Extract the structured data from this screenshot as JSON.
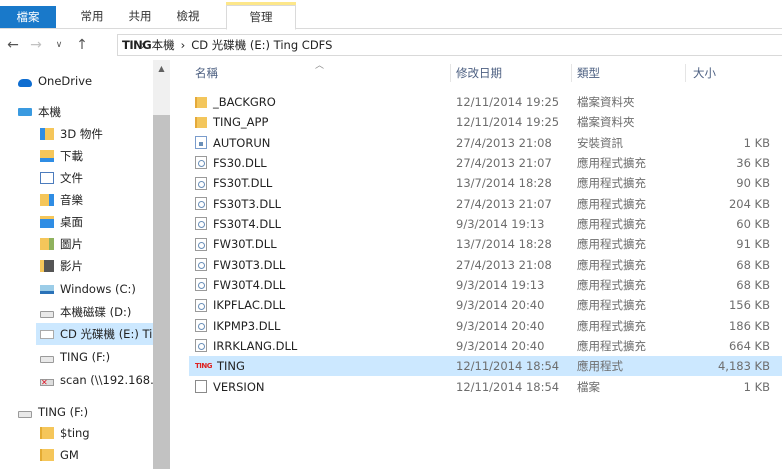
{
  "ribbon": {
    "tabs": [
      {
        "label": "檔案"
      },
      {
        "label": "常用"
      },
      {
        "label": "共用"
      },
      {
        "label": "檢視"
      },
      {
        "label": "管理"
      }
    ]
  },
  "address": {
    "logo_text": "TING",
    "crumbs": [
      "本機",
      "CD 光碟機 (E:) Ting CDFS"
    ]
  },
  "nav": {
    "items": [
      {
        "label": "OneDrive",
        "icon": "cloud-icon"
      },
      {
        "label": "本機",
        "icon": "computer-icon"
      },
      {
        "label": "3D 物件",
        "icon": "3d-objects-icon"
      },
      {
        "label": "下載",
        "icon": "downloads-icon"
      },
      {
        "label": "文件",
        "icon": "documents-icon"
      },
      {
        "label": "音樂",
        "icon": "music-icon"
      },
      {
        "label": "桌面",
        "icon": "desktop-icon"
      },
      {
        "label": "圖片",
        "icon": "pictures-icon"
      },
      {
        "label": "影片",
        "icon": "videos-icon"
      },
      {
        "label": "Windows (C:)",
        "icon": "windows-drive-icon"
      },
      {
        "label": "本機磁碟 (D:)",
        "icon": "drive-icon"
      },
      {
        "label": "CD 光碟機 (E:) Tir",
        "icon": "cd-drive-icon"
      },
      {
        "label": "TING (F:)",
        "icon": "drive-icon"
      },
      {
        "label": "scan (\\\\192.168.",
        "icon": "network-drive-icon"
      },
      {
        "label": "TING (F:)",
        "icon": "drive-icon"
      },
      {
        "label": "$ting",
        "icon": "folder-icon"
      },
      {
        "label": "GM",
        "icon": "folder-icon"
      }
    ]
  },
  "columns": {
    "name": "名稱",
    "date": "修改日期",
    "type": "類型",
    "size": "大小"
  },
  "files": [
    {
      "name": "_BACKGRO",
      "date": "12/11/2014 19:25",
      "type": "檔案資料夾",
      "size": "",
      "icon": "folder-icon"
    },
    {
      "name": "TING_APP",
      "date": "12/11/2014 19:25",
      "type": "檔案資料夾",
      "size": "",
      "icon": "folder-icon"
    },
    {
      "name": "AUTORUN",
      "date": "27/4/2013 21:08",
      "type": "安裝資訊",
      "size": "1 KB",
      "icon": "setup-info-icon"
    },
    {
      "name": "FS30.DLL",
      "date": "27/4/2013 21:07",
      "type": "應用程式擴充",
      "size": "36 KB",
      "icon": "dll-icon"
    },
    {
      "name": "FS30T.DLL",
      "date": "13/7/2014 18:28",
      "type": "應用程式擴充",
      "size": "90 KB",
      "icon": "dll-icon"
    },
    {
      "name": "FS30T3.DLL",
      "date": "27/4/2013 21:07",
      "type": "應用程式擴充",
      "size": "204 KB",
      "icon": "dll-icon"
    },
    {
      "name": "FS30T4.DLL",
      "date": "9/3/2014 19:13",
      "type": "應用程式擴充",
      "size": "60 KB",
      "icon": "dll-icon"
    },
    {
      "name": "FW30T.DLL",
      "date": "13/7/2014 18:28",
      "type": "應用程式擴充",
      "size": "91 KB",
      "icon": "dll-icon"
    },
    {
      "name": "FW30T3.DLL",
      "date": "27/4/2013 21:08",
      "type": "應用程式擴充",
      "size": "68 KB",
      "icon": "dll-icon"
    },
    {
      "name": "FW30T4.DLL",
      "date": "9/3/2014 19:13",
      "type": "應用程式擴充",
      "size": "68 KB",
      "icon": "dll-icon"
    },
    {
      "name": "IKPFLAC.DLL",
      "date": "9/3/2014 20:40",
      "type": "應用程式擴充",
      "size": "156 KB",
      "icon": "dll-icon"
    },
    {
      "name": "IKPMP3.DLL",
      "date": "9/3/2014 20:40",
      "type": "應用程式擴充",
      "size": "186 KB",
      "icon": "dll-icon"
    },
    {
      "name": "IRRKLANG.DLL",
      "date": "9/3/2014 20:40",
      "type": "應用程式擴充",
      "size": "664 KB",
      "icon": "dll-icon"
    },
    {
      "name": "TING",
      "date": "12/11/2014 18:54",
      "type": "應用程式",
      "size": "4,183 KB",
      "icon": "ting-app-icon"
    },
    {
      "name": "VERSION",
      "date": "12/11/2014 18:54",
      "type": "檔案",
      "size": "1 KB",
      "icon": "file-icon"
    }
  ]
}
